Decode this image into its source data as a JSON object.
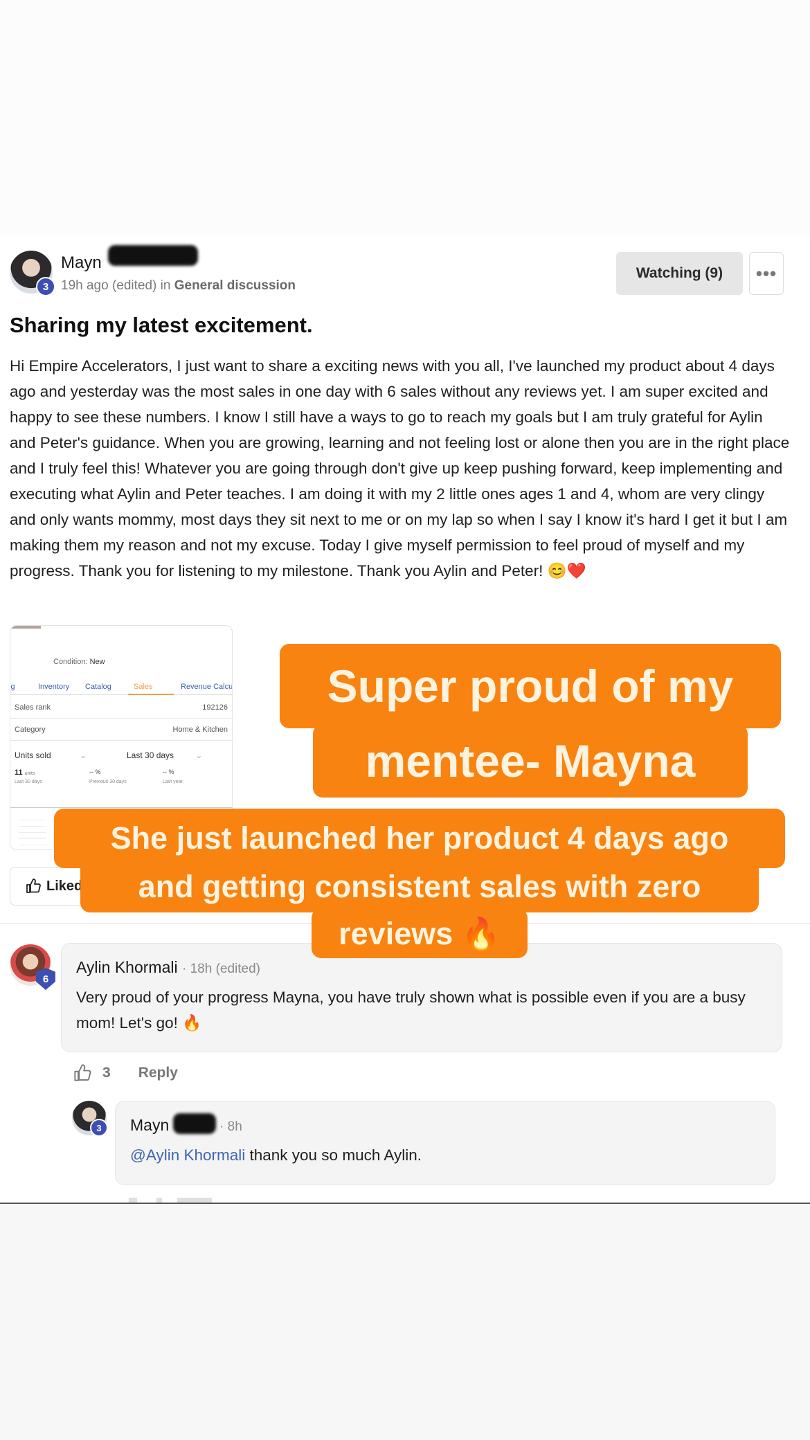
{
  "post": {
    "author": {
      "name": "Mayn",
      "level": "3"
    },
    "time": "19h ago (edited) in ",
    "category": "General discussion",
    "watch_label": "Watching (9)",
    "more_label": "•••",
    "title": "Sharing my latest excitement.",
    "body": "Hi Empire Accelerators, I just want to share a exciting news with you all, I've launched my product about 4 days ago and yesterday was the most sales in one day with 6 sales without any reviews yet. I am super excited and happy to see these numbers. I know I still have a ways to go to reach my goals but I am truly grateful for Aylin and Peter's guidance. When you are growing, learning and not feeling lost or alone then you are in the right place and I truly feel this! Whatever you are going through don't give up keep pushing forward, keep implementing and executing what Aylin and Peter teaches. I am doing it with my 2 little ones ages 1 and 4, whom are very clingy and only wants mommy, most days they sit next to me or on my lap so when I say I know it's hard I get it but I am making them my reason and not my excuse. Today I give myself permission to feel proud of myself and my progress. Thank you for listening to my milestone. Thank you Aylin and Peter! 😊❤️",
    "like_label": "Liked"
  },
  "screenshot": {
    "condition_label": "Condition:",
    "condition_value": "New",
    "tabs": [
      "ig",
      "Inventory",
      "Catalog",
      "Sales",
      "Revenue Calcu"
    ],
    "sales_rank_label": "Sales rank",
    "sales_rank_value": "192126",
    "category_label": "Category",
    "category_value": "Home & Kitchen",
    "units_label": "Units sold",
    "period_label": "Last 30 days",
    "units_value": "11",
    "units_unit": "units",
    "stat_labels": [
      "Last 30 days",
      "Previous 30 days",
      "Last year"
    ],
    "stat_values": [
      "--",
      "--"
    ]
  },
  "overlays": {
    "line1": "Super proud of my",
    "line2": "mentee- Mayna",
    "line3": "She just launched her product 4 days ago",
    "line4": "and getting consistent sales with zero",
    "line5": "reviews 🔥"
  },
  "comments": [
    {
      "name": "Aylin Khormali",
      "level": "6",
      "time": "· 18h (edited)",
      "text": "Very proud of your progress Mayna, you have truly shown what is possible even if you are a busy mom! Let's go! 🔥",
      "likes": "3",
      "reply_label": "Reply"
    },
    {
      "name": "Mayn",
      "level": "3",
      "time": "· 8h",
      "mention": "@Aylin Khormali",
      "text": " thank you so much Aylin."
    }
  ]
}
